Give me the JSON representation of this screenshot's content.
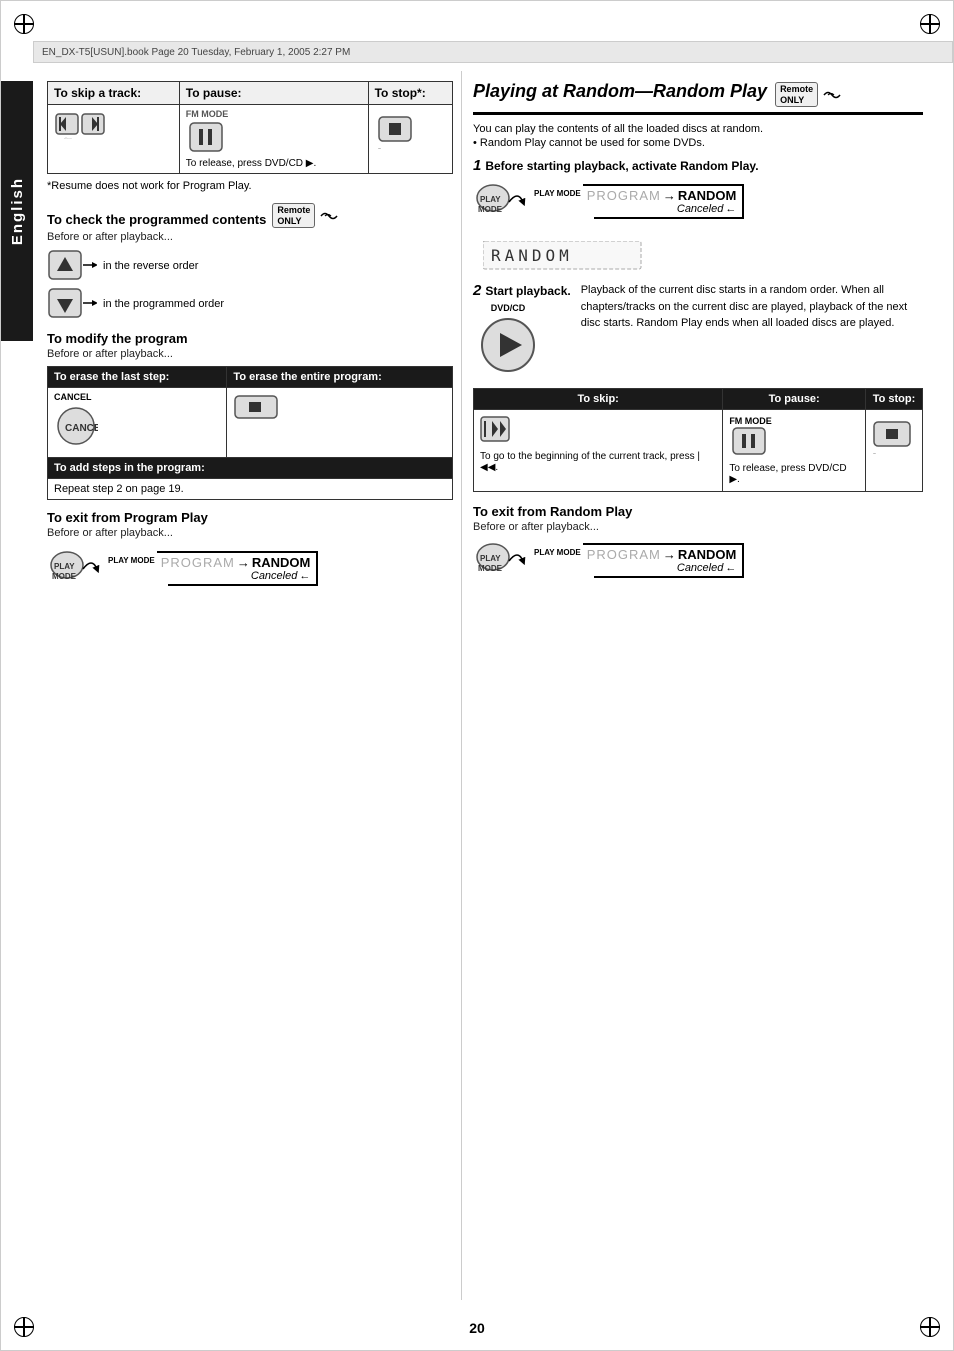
{
  "page": {
    "number": "20",
    "header": "EN_DX-T5[USUN].book  Page 20  Tuesday, February 1, 2005  2:27 PM"
  },
  "sidebar": {
    "label": "English"
  },
  "left_column": {
    "skip_pause_stop": {
      "headers": [
        "To skip a track:",
        "To pause:",
        "To stop*:"
      ],
      "pause_note": "To release, press DVD/CD ▶.",
      "footnote": "*Resume does not work for Program Play."
    },
    "check_programmed": {
      "heading": "To check the programmed contents",
      "sub": "Before or after playback...",
      "row1": "in the reverse order",
      "row2": "in the programmed order",
      "remote_badge": "Remote ONLY"
    },
    "modify_program": {
      "heading": "To modify the program",
      "sub": "Before or after playback...",
      "col1_header": "To erase the last step:",
      "col2_header": "To erase the entire program:",
      "cancel_label": "CANCEL",
      "add_steps_header": "To add steps in the program:",
      "add_steps_text": "Repeat step 2 on page 19."
    },
    "exit_program": {
      "heading": "To exit from Program Play",
      "sub": "Before or after playback...",
      "play_mode_label": "PLAY MODE",
      "program_text": "PROGRAM",
      "arrow": "→",
      "random_text": "RANDOM",
      "canceled_text": "Canceled"
    }
  },
  "right_column": {
    "title": "Playing at Random—Random Play",
    "remote_badge": "Remote ONLY",
    "intro1": "You can play the contents of all the loaded discs at random.",
    "intro2": "• Random Play cannot be used for some DVDs.",
    "step1": {
      "number": "1",
      "text": "Before starting playback, activate Random Play.",
      "play_mode_label": "PLAY MODE",
      "program_text": "PROGRAM",
      "arrow": "→",
      "random_text": "RANDOM",
      "canceled_text": "Canceled"
    },
    "step2": {
      "number": "2",
      "text": "Start playback.",
      "dvd_cd_label": "DVD/CD",
      "description": "Playback of the current disc starts in a random order. When all chapters/tracks on the current disc are played, playback of the next disc starts. Random Play ends when all loaded discs are played."
    },
    "skip_pause_stop": {
      "headers": [
        "To skip:",
        "To pause:",
        "To stop:"
      ],
      "skip_note": "To go to the beginning of the current track, press |◀◀.",
      "pause_label": "FM MODE",
      "pause_note": "To release, press DVD/CD ▶."
    },
    "exit_random": {
      "heading": "To exit from Random Play",
      "sub": "Before or after playback...",
      "play_mode_label": "PLAY MODE",
      "program_text": "PROGRAM",
      "arrow": "→",
      "random_text": "RANDOM",
      "canceled_text": "Canceled"
    }
  }
}
